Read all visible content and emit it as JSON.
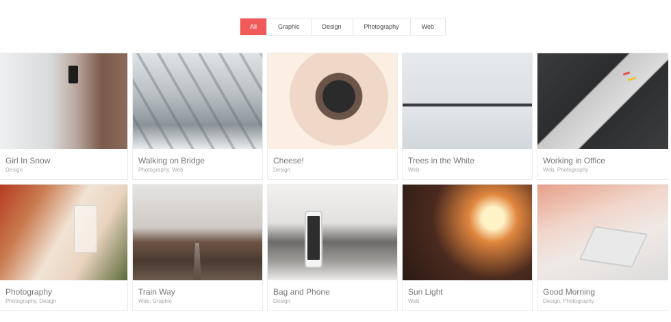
{
  "filters": [
    {
      "label": "All",
      "active": true
    },
    {
      "label": "Graphic",
      "active": false
    },
    {
      "label": "Design",
      "active": false
    },
    {
      "label": "Photography",
      "active": false
    },
    {
      "label": "Web",
      "active": false
    }
  ],
  "accent_color": "#f25a5a",
  "portfolio": {
    "rows": [
      [
        {
          "title": "Girl In Snow",
          "categories": "Design"
        },
        {
          "title": "Walking on Bridge",
          "categories": "Photography, Web"
        },
        {
          "title": "Cheese!",
          "categories": "Design"
        },
        {
          "title": "Trees in the White",
          "categories": "Web"
        },
        {
          "title": "Working in Office",
          "categories": "Web, Photography"
        }
      ],
      [
        {
          "title": "Photography",
          "categories": "Photography, Design"
        },
        {
          "title": "Train Way",
          "categories": "Web, Graphic"
        },
        {
          "title": "Bag and Phone",
          "categories": "Design"
        },
        {
          "title": "Sun Light",
          "categories": "Web"
        },
        {
          "title": "Good Morning",
          "categories": "Design, Photography"
        }
      ]
    ]
  }
}
